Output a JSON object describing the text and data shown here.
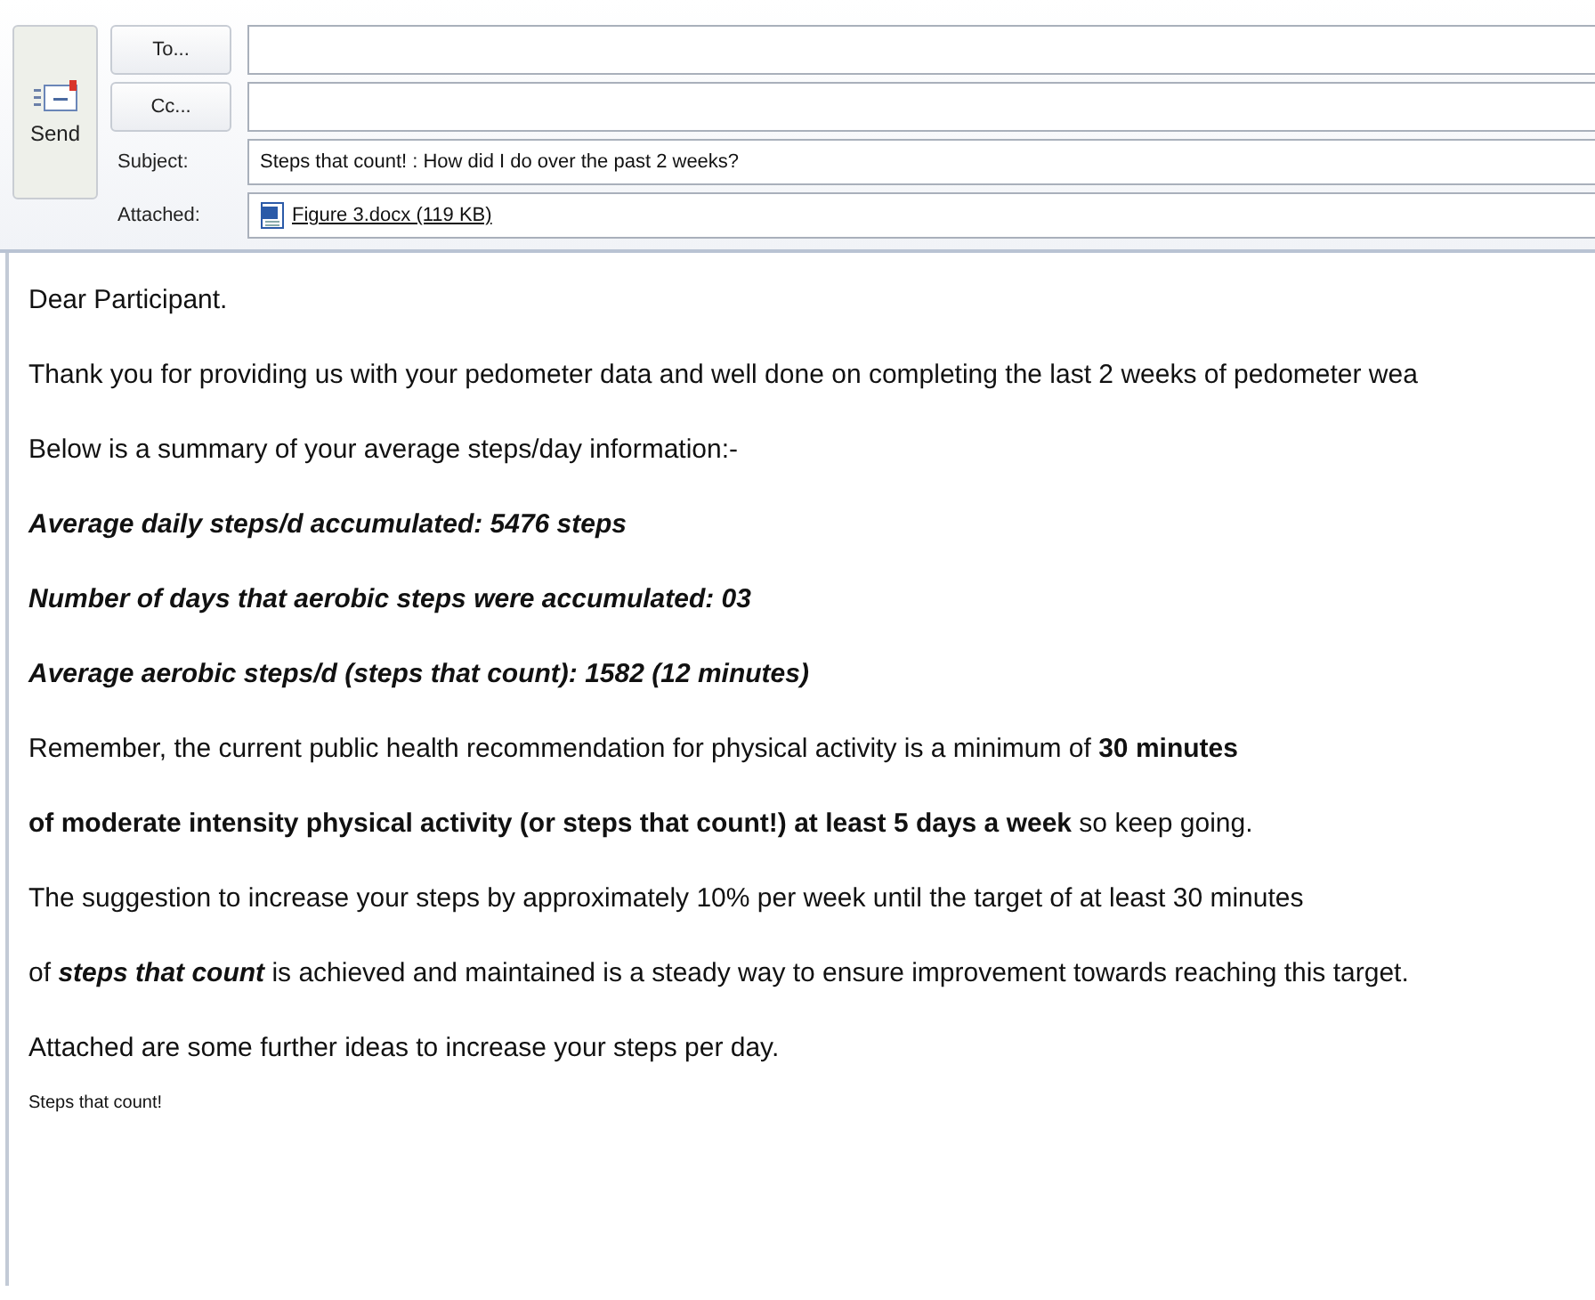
{
  "send_button": {
    "label": "Send"
  },
  "to_button": {
    "label": "To..."
  },
  "cc_button": {
    "label": "Cc..."
  },
  "subject": {
    "label": "Subject:",
    "value": "Steps that count! :  How did I do over the past 2 weeks?"
  },
  "attached": {
    "label": "Attached:",
    "file": "Figure 3.docx (119 KB)"
  },
  "body": [
    {
      "kind": "plain",
      "text": "Dear Participant."
    },
    {
      "kind": "plain",
      "text": "Thank you for providing us with your pedometer data and well done on completing the last 2 weeks of pedometer wea"
    },
    {
      "kind": "plain",
      "text": "Below is a summary of your average steps/day information:-"
    },
    {
      "kind": "emphasis",
      "text": "Average daily steps/d accumulated: 5476 steps"
    },
    {
      "kind": "emphasis",
      "text": "Number of days that aerobic steps were accumulated: 03"
    },
    {
      "kind": "emphasis",
      "text": "Average aerobic steps/d (steps that count): 1582 (12 minutes)"
    },
    {
      "kind": "plain",
      "text": "Remember, the current public health recommendation for physical activity is a minimum of **30 minutes**"
    },
    {
      "kind": "plain",
      "text": "**of moderate intensity physical activity (or steps that count!) at least 5 days a week** so keep going."
    },
    {
      "kind": "plain",
      "text": "The suggestion to increase your steps by approximately 10% per week until the target of at least 30 minutes"
    },
    {
      "kind": "italic_accent",
      "text": "of **steps that count** is achieved and maintained is a steady way to ensure improvement towards reaching this target."
    },
    {
      "kind": "plain",
      "text": "Attached are some further ideas to increase your steps per day."
    },
    {
      "kind": "small",
      "text": "Steps that count!"
    }
  ]
}
